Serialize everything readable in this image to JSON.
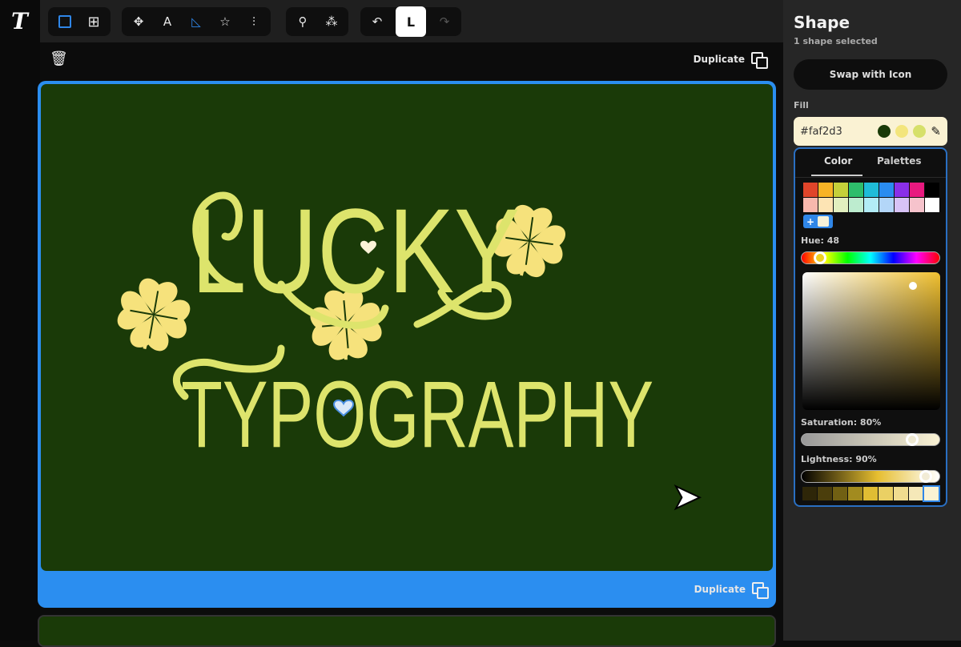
{
  "app": {
    "logo": "T"
  },
  "toolbar": {
    "view_tools": [
      {
        "icon": "single-view-icon",
        "active": true
      },
      {
        "icon": "grid-view-icon",
        "active": false
      }
    ],
    "shape_tools": [
      {
        "icon": "select-move-icon",
        "glyph": "✥"
      },
      {
        "icon": "select-text-icon",
        "glyph": "A"
      },
      {
        "icon": "select-shape-icon",
        "glyph": "◺",
        "active": true
      },
      {
        "icon": "select-star-icon",
        "glyph": "☆"
      },
      {
        "icon": "select-distribute-icon",
        "glyph": "⫶"
      }
    ],
    "node_tools": [
      {
        "icon": "node-edit-icon",
        "glyph": "⚲"
      },
      {
        "icon": "node-points-icon",
        "glyph": "⁂"
      }
    ],
    "history": {
      "undo": "↶",
      "mode_label": "L",
      "redo": "↷"
    }
  },
  "canvas": {
    "duplicate_label": "Duplicate",
    "artwork": {
      "line1": "LUCKY",
      "line2": "TYPOGRAPHY",
      "text_color": "#dde46c",
      "clover_color": "#f6e27c",
      "background": "#1a3a08"
    }
  },
  "panel": {
    "title": "Shape",
    "subtitle": "1 shape selected",
    "swap_button": "Swap with Icon",
    "fill_label": "Fill",
    "fill_hex": "#faf2d3",
    "recent_colors": [
      "#1a3a08",
      "#f3e57c",
      "#d6e06a"
    ],
    "tabs": [
      "Color",
      "Palettes"
    ],
    "swatches": [
      "#e0452a",
      "#f7b326",
      "#c4d03a",
      "#2ebd6b",
      "#1fbcd8",
      "#2a8cf0",
      "#8a2fe8",
      "#e8197f",
      "#000000",
      "#f8b8ad",
      "#fde4b4",
      "#e2efbf",
      "#bdeccf",
      "#b2ecf6",
      "#b3d6f8",
      "#d8c3f6",
      "#f6c3cc",
      "#ffffff"
    ],
    "add_label": "+",
    "hue_label": "Hue: 48",
    "hue": 48,
    "saturation_label": "Saturation: 80%",
    "saturation": 80,
    "lightness_label": "Lightness: 90%",
    "lightness": 90,
    "shades": [
      "#2e2608",
      "#4b3e0c",
      "#716013",
      "#a28b1f",
      "#e0bd33",
      "#ead064",
      "#f0dc8f",
      "#f5e8b8",
      "#faf2d3"
    ]
  }
}
